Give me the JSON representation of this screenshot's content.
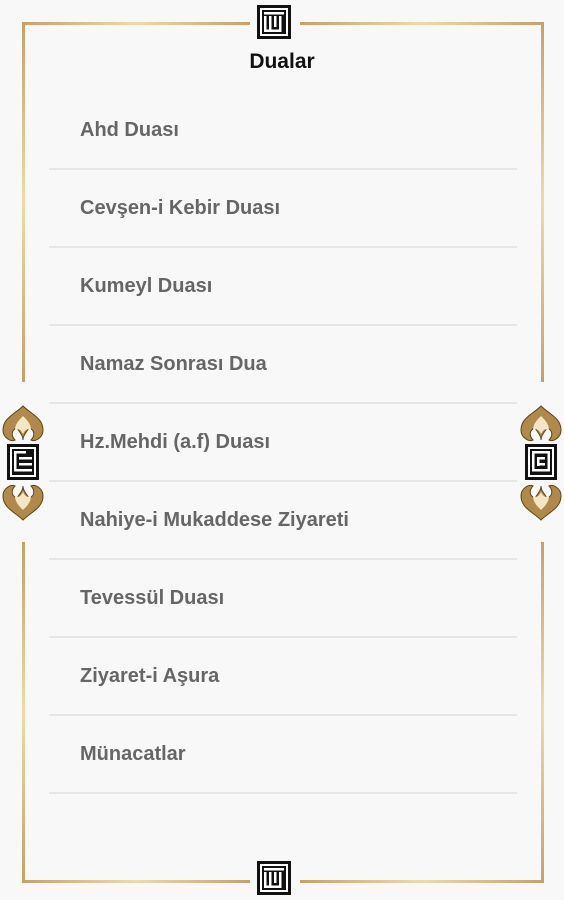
{
  "header": {
    "title": "Dualar"
  },
  "list": {
    "items": [
      {
        "label": "Ahd Duası"
      },
      {
        "label": "Cevşen-i Kebir Duası"
      },
      {
        "label": "Kumeyl Duası"
      },
      {
        "label": "Namaz Sonrası Dua"
      },
      {
        "label": "Hz.Mehdi (a.f) Duası"
      },
      {
        "label": "Nahiye-i Mukaddese Ziyareti"
      },
      {
        "label": "Tevessül Duası"
      },
      {
        "label": "Ziyaret-i Aşura"
      },
      {
        "label": "Münacatlar"
      }
    ]
  },
  "decor": {
    "frame_color": "#c9a063",
    "frame_highlight": "#f1d9a7",
    "emblem_color": "#111111",
    "text_color": "#666666",
    "divider_color": "#e6e6e6",
    "emblem_icon": "kufic-calligraphy-icon",
    "ornament_icon": "arabesque-ornament-icon"
  }
}
